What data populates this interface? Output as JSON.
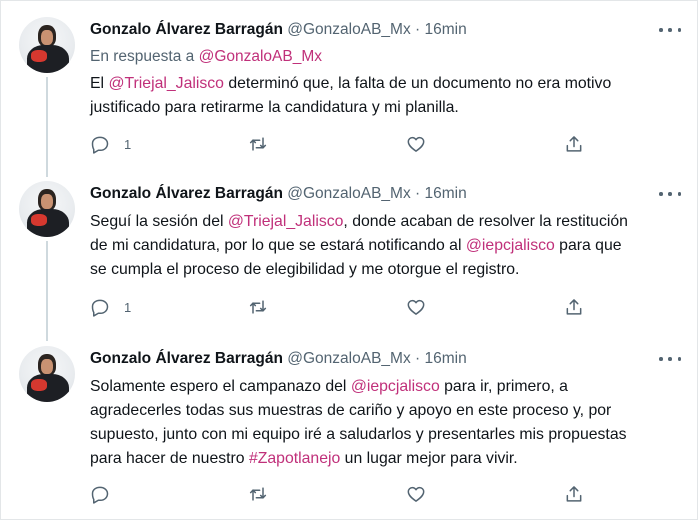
{
  "tweets": [
    {
      "author": {
        "name": "Gonzalo Álvarez Barragán",
        "handle": "@GonzaloAB_Mx",
        "separator": "·",
        "time": "16min"
      },
      "reply_to": {
        "prefix": "En respuesta a ",
        "handle": "@GonzaloAB_Mx"
      },
      "text_parts": [
        {
          "text": "El ",
          "kind": "plain"
        },
        {
          "text": "@Triejal_Jalisco",
          "kind": "mention"
        },
        {
          "text": " determinó que, la falta de un documento no era motivo\njustificado para retirarme la candidatura y mi planilla.",
          "kind": "plain"
        }
      ],
      "actions": {
        "reply_count": "1",
        "retweet_count": "",
        "like_count": ""
      }
    },
    {
      "author": {
        "name": "Gonzalo Álvarez Barragán",
        "handle": "@GonzaloAB_Mx",
        "separator": "·",
        "time": "16min"
      },
      "text_parts": [
        {
          "text": "Seguí la sesión del ",
          "kind": "plain"
        },
        {
          "text": "@Triejal_Jalisco",
          "kind": "mention"
        },
        {
          "text": ", donde acaban de resolver la restitución\nde mi candidatura, por lo que se estará notificando al ",
          "kind": "plain"
        },
        {
          "text": "@iepcjalisco",
          "kind": "mention"
        },
        {
          "text": " para que\nse cumpla el proceso de elegibilidad y me otorgue el registro.",
          "kind": "plain"
        }
      ],
      "actions": {
        "reply_count": "1",
        "retweet_count": "",
        "like_count": ""
      }
    },
    {
      "author": {
        "name": "Gonzalo Álvarez Barragán",
        "handle": "@GonzaloAB_Mx",
        "separator": "·",
        "time": "16min"
      },
      "text_parts": [
        {
          "text": "Solamente espero el campanazo del ",
          "kind": "plain"
        },
        {
          "text": "@iepcjalisco",
          "kind": "mention"
        },
        {
          "text": " para ir, primero, a\nagradecerles todas sus muestras de cariño y apoyo en este proceso y, por\nsupuesto, junto con mi equipo iré a saludarlos y presentarles mis propuestas\npara hacer de nuestro ",
          "kind": "plain"
        },
        {
          "text": "#Zapotlanejo",
          "kind": "hashtag"
        },
        {
          "text": " un lugar mejor para vivir.",
          "kind": "plain"
        }
      ],
      "actions": {
        "reply_count": "",
        "retweet_count": "",
        "like_count": ""
      }
    }
  ],
  "icons": {
    "reply": "reply-bubble-icon",
    "retweet": "retweet-arrows-icon",
    "like": "heart-icon",
    "share": "share-upload-icon",
    "more": "more-dots-icon"
  },
  "colors": {
    "text": "#0f1419",
    "secondary": "#536471",
    "mention": "#c0307a",
    "thread_line": "#cfd9de"
  }
}
